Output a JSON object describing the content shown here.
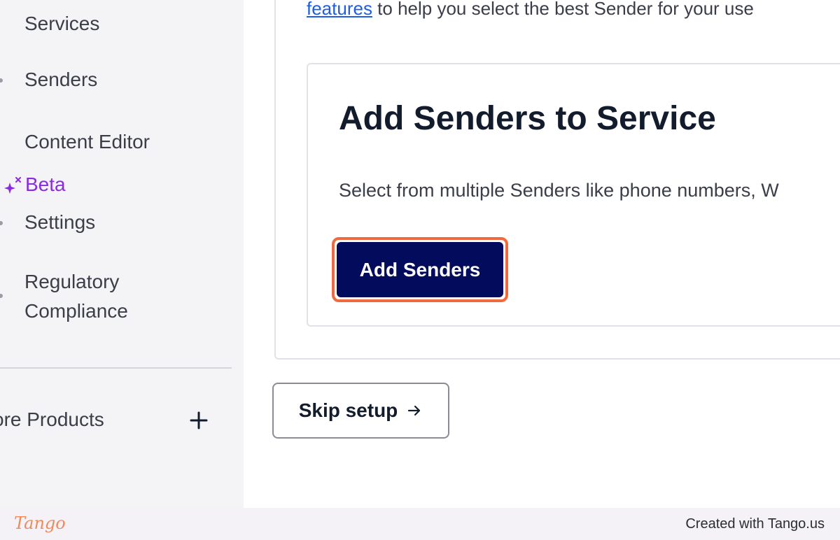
{
  "sidebar": {
    "items": [
      {
        "label": "Services"
      },
      {
        "label": "Senders"
      },
      {
        "label": "Content Editor"
      },
      {
        "label": "Settings"
      },
      {
        "label": "Regulatory Compliance",
        "line1": "Regulatory",
        "line2": "Compliance"
      }
    ],
    "beta_label": "Beta",
    "more_products_label": "ore Products",
    "plus_icon": "plus-icon",
    "beta_icon": "sparkle-icon"
  },
  "main": {
    "intro_link": "features",
    "intro_text": " to help you select the best Sender for your use",
    "card": {
      "title": "Add Senders to Service",
      "description": "Select from multiple Senders like phone numbers, W",
      "button_label": "Add Senders"
    },
    "skip_button_label": "Skip setup",
    "skip_icon": "arrow-right-icon"
  },
  "footer": {
    "logo_text": "Tango",
    "credit": "Created with Tango.us"
  },
  "colors": {
    "primary_button": "#030b5d",
    "highlight": "#f06a40",
    "beta": "#8a2be2",
    "link": "#1e5ee6"
  }
}
